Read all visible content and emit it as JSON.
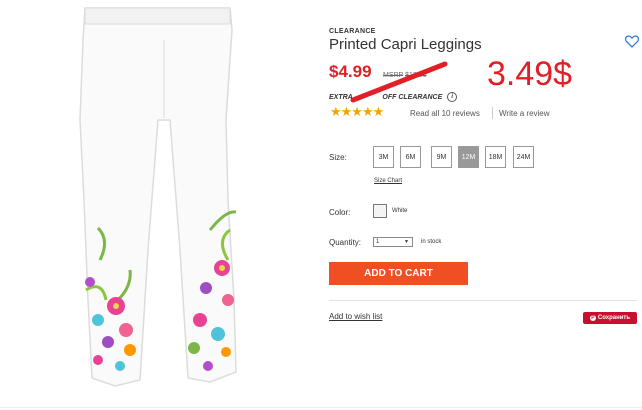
{
  "product": {
    "badge": "CLEARANCE",
    "title": "Printed Capri Leggings",
    "price": "$4.99",
    "msrp_label": "MSRP",
    "msrp_value": "$12.00",
    "handwritten_price": "3.49$",
    "promo_left": "EXTRA",
    "promo_right": "OFF CLEARANCE",
    "info_icon_glyph": "i",
    "stars": "★★★★★",
    "rating_color": "#f1a500",
    "reviews_link": "Read all 10 reviews",
    "write_review": "Write a review"
  },
  "options": {
    "size_label": "Size:",
    "sizes": [
      "3M",
      "6M",
      "9M",
      "12M",
      "18M",
      "24M"
    ],
    "selected_size": "12M",
    "size_chart": "Size Chart",
    "color_label": "Color:",
    "color_value": "White",
    "quantity_label": "Quantity:",
    "quantity_value": "1",
    "stock": "in stock"
  },
  "actions": {
    "add_to_cart": "ADD TO CART",
    "add_to_wishlist": "Add to wish list",
    "pinterest_save": "Сохранить",
    "pinterest_icon_glyph": "P"
  },
  "colors": {
    "price_red": "#e21f26",
    "cart_orange": "#f04e23",
    "pinterest_red": "#c8102e"
  },
  "icons": [
    "heart-icon",
    "info-icon",
    "pinterest-icon",
    "chevron-down-icon"
  ]
}
